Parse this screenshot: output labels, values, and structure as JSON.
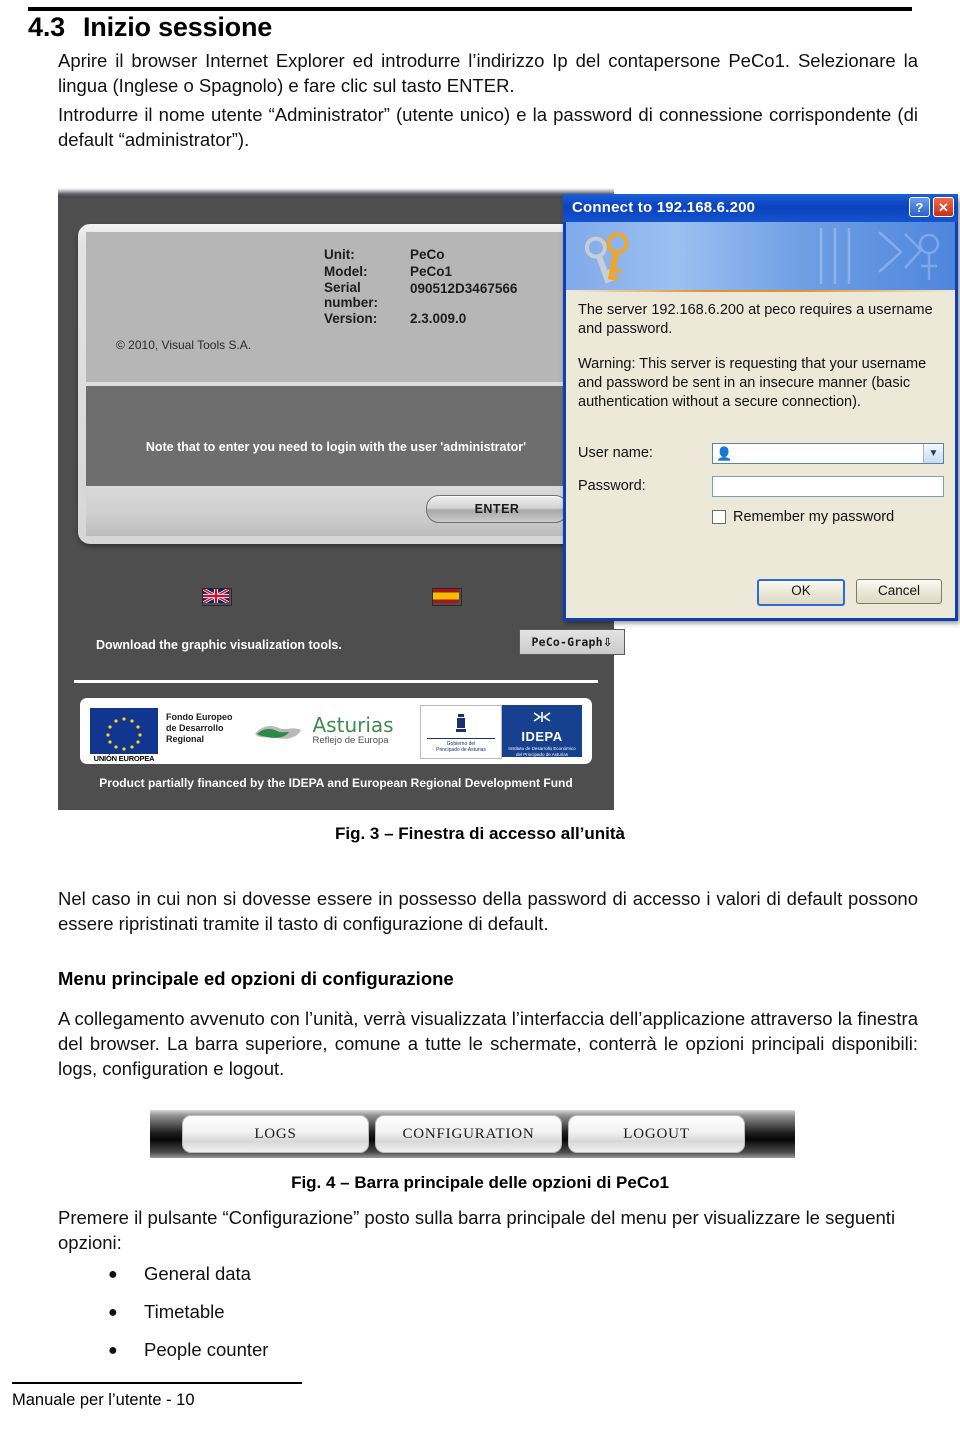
{
  "document": {
    "section_number": "4.3",
    "section_title": "Inizio sessione",
    "paragraph_1": "Aprire il browser Internet Explorer ed introdurre l’indirizzo Ip del contapersone PeCo1. Selezionare la lingua (Inglese o Spagnolo) e fare clic sul tasto ENTER.",
    "paragraph_2": "Introdurre il nome utente “Administrator” (utente unico) e la password di connessione corrispondente (di default “administrator”).",
    "caption_fig3": "Fig. 3 – Finestra di accesso all’unità",
    "paragraph_3": "Nel caso in cui non si dovesse essere in possesso della password di accesso i valori di default possono essere ripristinati tramite il tasto di configurazione di default.",
    "sub_heading": "Menu principale ed opzioni di configurazione",
    "paragraph_4": "A collegamento avvenuto con l’unità, verrà visualizzata l’interfaccia dell’applicazione attraverso la finestra del browser. La barra superiore, comune a tutte le schermate, conterrà le opzioni principali disponibili: logs, configuration e logout.",
    "caption_fig4": "Fig. 4 – Barra principale delle opzioni di PeCo1",
    "paragraph_5": "Premere il pulsante “Configurazione” posto sulla barra principale del menu per visualizzare le seguenti opzioni:",
    "bullets": [
      "General data",
      "Timetable",
      "People counter"
    ],
    "footer": "Manuale per l’utente - 10"
  },
  "fig3_login_screen": {
    "device_info": {
      "unit_label": "Unit:",
      "unit_value": "PeCo",
      "model_label": "Model:",
      "model_value": "PeCo1",
      "serial_label": "Serial number:",
      "serial_value": "090512D3467566",
      "version_label": "Version:",
      "version_value": "2.3.009.0"
    },
    "copyright": "© 2010, Visual Tools S.A.",
    "note": "Note that to enter you need to login with the user 'administrator'",
    "enter_button": "ENTER",
    "flag_en_name": "united-kingdom-flag",
    "flag_es_name": "spain-flag",
    "download_text": "Download the graphic visualization tools.",
    "peco_graph_button": "PeCo-Graph",
    "download_arrow": "⇩",
    "logos": {
      "eu_caption": "UNIÓN EUROPEA",
      "eu_text_line1": "Fondo Europeo",
      "eu_text_line2": "de Desarrollo",
      "eu_text_line3": "Regional",
      "asturias_word": "Asturias",
      "asturias_sub": "Reflejo de Europa",
      "gov_line1": "Gobierno del",
      "gov_line2": "Principado de Asturias",
      "idepa_name": "IDEPA",
      "idepa_sub1": "Instituto de Desarrollo Económico",
      "idepa_sub2": "del Principado de Asturias"
    },
    "funding_text": "Product partially financed by the IDEPA and European Regional Development Fund"
  },
  "credentials_dialog": {
    "title": "Connect to 192.168.6.200",
    "help_button": "?",
    "close_button": "✕",
    "key_icon_name": "keys-icon",
    "message_1": "The server 192.168.6.200 at peco requires a username and password.",
    "message_2": "Warning: This server is requesting that your username and password be sent in an insecure manner (basic authentication without a secure connection).",
    "username_label": "User name:",
    "username_value": "",
    "username_glyph": "👤",
    "password_label": "Password:",
    "password_value": "",
    "remember_label": "Remember my password",
    "remember_checked": false,
    "ok_button": "OK",
    "cancel_button": "Cancel",
    "combo_arrow": "▼"
  },
  "fig4_toolbar": {
    "buttons": [
      "LOGS",
      "CONFIGURATION",
      "LOGOUT"
    ]
  },
  "colors": {
    "dialog_title_blue": "#0b43bd",
    "dialog_face": "#ece9d8",
    "app_dark_gray": "#4e4e4e",
    "idepa_blue": "#17418f",
    "asturias_green": "#3f8a4f",
    "eu_blue": "#10368f"
  }
}
